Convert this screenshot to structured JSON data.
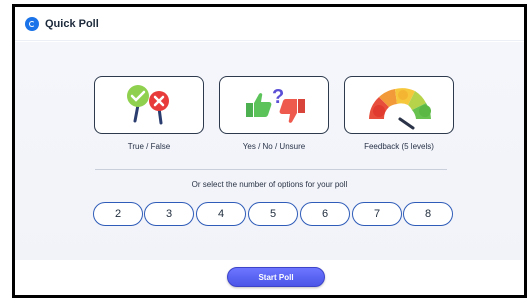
{
  "window": {
    "title": "Quick Poll",
    "logo_icon": "quickpoll-logo-icon"
  },
  "poll_types": [
    {
      "label": "True / False",
      "icon": "check-cross-icon"
    },
    {
      "label": "Yes / No / Unsure",
      "icon": "thumbs-question-icon"
    },
    {
      "label": "Feedback (5 levels)",
      "icon": "feedback-gauge-icon"
    }
  ],
  "options": {
    "prompt": "Or select the number of options for your poll",
    "values": [
      "2",
      "3",
      "4",
      "5",
      "6",
      "7",
      "8"
    ]
  },
  "footer": {
    "start_label": "Start Poll"
  },
  "colors": {
    "accent": "#5a63f3",
    "outline": "#2f5cb8",
    "background": "#f3f4f9"
  }
}
